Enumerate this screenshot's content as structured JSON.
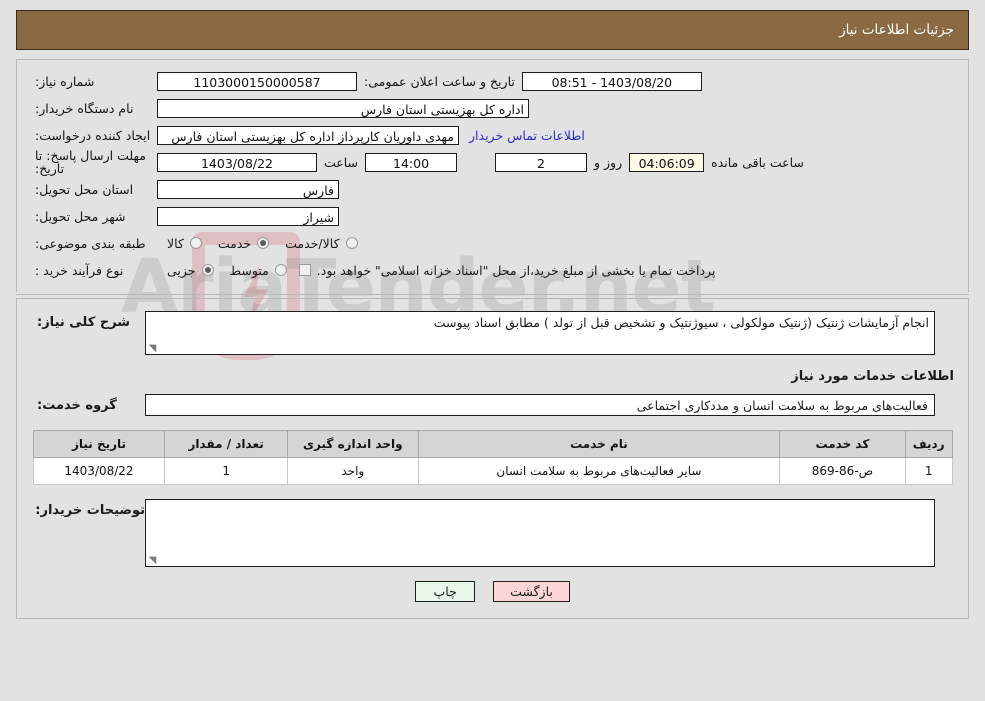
{
  "header": {
    "title": "جزئیات اطلاعات نیاز"
  },
  "watermark": {
    "text": "AriaTender.net"
  },
  "form": {
    "need_number_label": "شماره نیاز:",
    "need_number_value": "1103000150000587",
    "public_announce_label": "تاریخ و ساعت اعلان عمومی:",
    "public_announce_value": "1403/08/20 - 08:51",
    "buyer_org_label": "نام دستگاه خریدار:",
    "buyer_org_value": "اداره کل بهزیستی استان فارس",
    "creator_label": "ایجاد کننده درخواست:",
    "creator_value": "مهدی داوریان کارپرداز اداره کل بهزیستی استان فارس",
    "contact_link": "اطلاعات تماس خریدار",
    "deadline_label": "مهلت ارسال پاسخ: تا تاریخ:",
    "deadline_date": "1403/08/22",
    "hour_label": "ساعت",
    "hour_value": "14:00",
    "days_value": "2",
    "days_label": "روز و",
    "countdown_value": "04:06:09",
    "countdown_label": "ساعت باقی مانده",
    "delivery_province_label": "استان محل تحویل:",
    "delivery_province_value": "فارس",
    "delivery_city_label": "شهر محل تحویل:",
    "delivery_city_value": "شیراز",
    "category_label": "طبقه بندی موضوعی:",
    "category_options": [
      {
        "label": "کالا",
        "selected": false
      },
      {
        "label": "خدمت",
        "selected": true
      },
      {
        "label": "کالا/خدمت",
        "selected": false
      }
    ],
    "process_label": "نوع فرآیند خرید :",
    "process_options": [
      {
        "label": "جزیی",
        "selected": true
      },
      {
        "label": "متوسط",
        "selected": false
      }
    ],
    "treasury_checkbox_checked": false,
    "treasury_note": "پرداخت تمام یا بخشی از مبلغ خرید،از محل \"اسناد خزانه اسلامی\" خواهد بود."
  },
  "description": {
    "label": "شرح کلی نیاز:",
    "value": "انجام آزمایشات ژنتیک (ژنتیک مولکولی ، سیوژنتیک و تشخیص قبل از تولد ) مطابق اسناد پیوست"
  },
  "services_section": {
    "heading": "اطلاعات خدمات مورد نیاز",
    "group_label": "گروه خدمت:",
    "group_value": "فعالیت‌های مربوط به سلامت انسان و مددکاری اجتماعی"
  },
  "items_table": {
    "columns": [
      "ردیف",
      "کد خدمت",
      "نام خدمت",
      "واحد اندازه گیری",
      "تعداد / مقدار",
      "تاریخ نیاز"
    ],
    "rows": [
      {
        "row_no": "1",
        "code": "ص-86-869",
        "name": "سایر فعالیت‌های مربوط به سلامت انسان",
        "unit": "واحد",
        "quantity": "1",
        "need_date": "1403/08/22"
      }
    ]
  },
  "buyer_notes": {
    "label": "توضیحات خریدار:",
    "value": ""
  },
  "buttons": {
    "print": "چاپ",
    "back": "بازگشت"
  },
  "colors": {
    "header_bg": "#8a6a42",
    "page_bg": "#e2e2e2",
    "link": "#2b2bc8",
    "print_btn": "#e9f7ea",
    "back_btn": "#fad6d6",
    "countdown_bg": "#fbfbe8"
  }
}
